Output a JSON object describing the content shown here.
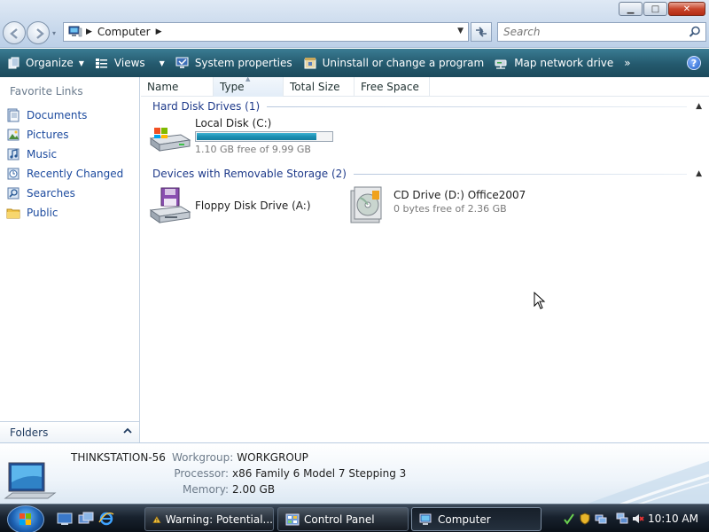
{
  "window": {
    "minimize_glyph": "▁",
    "maximize_glyph": "□",
    "close_glyph": "✕"
  },
  "address": {
    "location": "Computer",
    "icon": "computer-icon"
  },
  "search": {
    "placeholder": "Search"
  },
  "commands": {
    "organize": "Organize",
    "views": "Views",
    "system_properties": "System properties",
    "uninstall": "Uninstall or change a program",
    "map_drive": "Map network drive",
    "more": "»",
    "help": "?"
  },
  "navpane": {
    "heading": "Favorite Links",
    "items": [
      {
        "label": "Documents",
        "icon": "documents-icon"
      },
      {
        "label": "Pictures",
        "icon": "pictures-icon"
      },
      {
        "label": "Music",
        "icon": "music-icon"
      },
      {
        "label": "Recently Changed",
        "icon": "recently-changed-icon"
      },
      {
        "label": "Searches",
        "icon": "searches-icon"
      },
      {
        "label": "Public",
        "icon": "public-folder-icon"
      }
    ],
    "folders": "Folders"
  },
  "columns": [
    "Name",
    "Type",
    "Total Size",
    "Free Space"
  ],
  "groups": {
    "hard_disks": {
      "label": "Hard Disk Drives (1)",
      "drives": [
        {
          "name": "Local Disk (C:)",
          "free": "1.10 GB free of 9.99 GB",
          "used_fraction": 0.89
        }
      ]
    },
    "removable": {
      "label": "Devices with Removable Storage (2)",
      "drives": [
        {
          "name": "Floppy Disk Drive (A:)"
        },
        {
          "name": "CD Drive (D:) Office2007",
          "free": "0 bytes free of 2.36 GB"
        }
      ]
    }
  },
  "details": {
    "computer_name": "THINKSTATION-56",
    "workgroup_label": "Workgroup:",
    "workgroup": "WORKGROUP",
    "processor_label": "Processor:",
    "processor": "x86 Family 6 Model 7 Stepping 3",
    "memory_label": "Memory:",
    "memory": "2.00 GB"
  },
  "taskbar": {
    "tasks": [
      {
        "label": "Warning: Potential...",
        "active": false
      },
      {
        "label": "Control Panel",
        "active": false
      },
      {
        "label": "Computer",
        "active": true
      }
    ],
    "clock": "10:10 AM"
  },
  "colors": {
    "link_blue": "#1c4a9e",
    "group_blue": "#1e3a8a",
    "command_bar": "#24596d",
    "capacity_fill": "#1a8fb3",
    "close_red": "#c8452b"
  }
}
